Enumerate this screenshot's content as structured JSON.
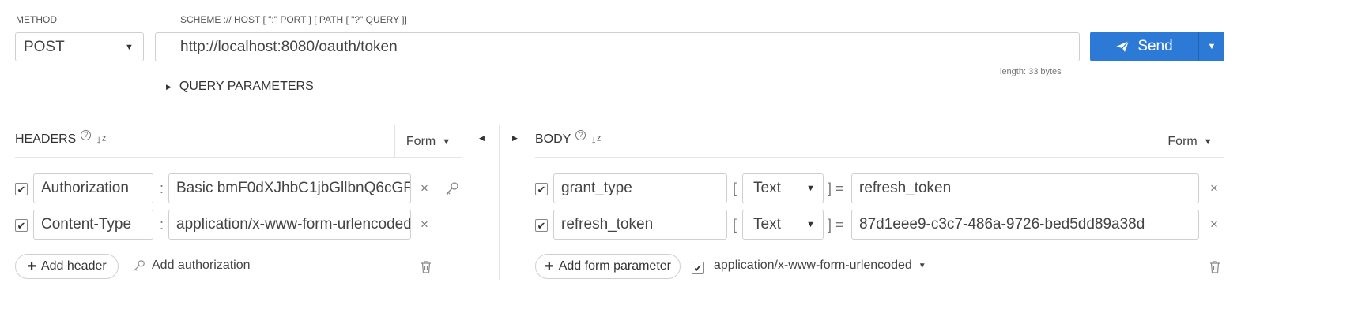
{
  "labels": {
    "method": "METHOD",
    "scheme": "SCHEME :// HOST [ \":\" PORT ] [ PATH [ \"?\" QUERY ]]",
    "length": "length: 33 bytes",
    "query_params": "QUERY PARAMETERS"
  },
  "method": {
    "value": "POST"
  },
  "url": {
    "value": "http://localhost:8080/oauth/token"
  },
  "send": {
    "label": "Send",
    "color": "#2d7ad6"
  },
  "headers": {
    "title": "HEADERS",
    "form_label": "Form",
    "rows": [
      {
        "name": "Authorization",
        "value": "Basic bmF0dXJhbC1jbGllbnQ6cGF",
        "checked": true
      },
      {
        "name": "Content-Type",
        "value": "application/x-www-form-urlencoded",
        "checked": true
      }
    ],
    "add_label": "Add header",
    "auth_label": "Add authorization"
  },
  "body": {
    "title": "BODY",
    "form_label": "Form",
    "rows": [
      {
        "name": "grant_type",
        "type": "Text",
        "value": "refresh_token",
        "checked": true
      },
      {
        "name": "refresh_token",
        "type": "Text",
        "value": "87d1eee9-c3c7-486a-9726-bed5dd89a38d",
        "checked": true
      }
    ],
    "add_label": "Add form parameter",
    "content_type": "application/x-www-form-urlencoded"
  },
  "icons": {
    "send": "paper-plane-icon",
    "dropdown": "caret-down-icon",
    "remove": "close-icon",
    "key": "key-icon",
    "trash": "trash-icon",
    "help": "help-icon",
    "sort": "sort-icon"
  }
}
